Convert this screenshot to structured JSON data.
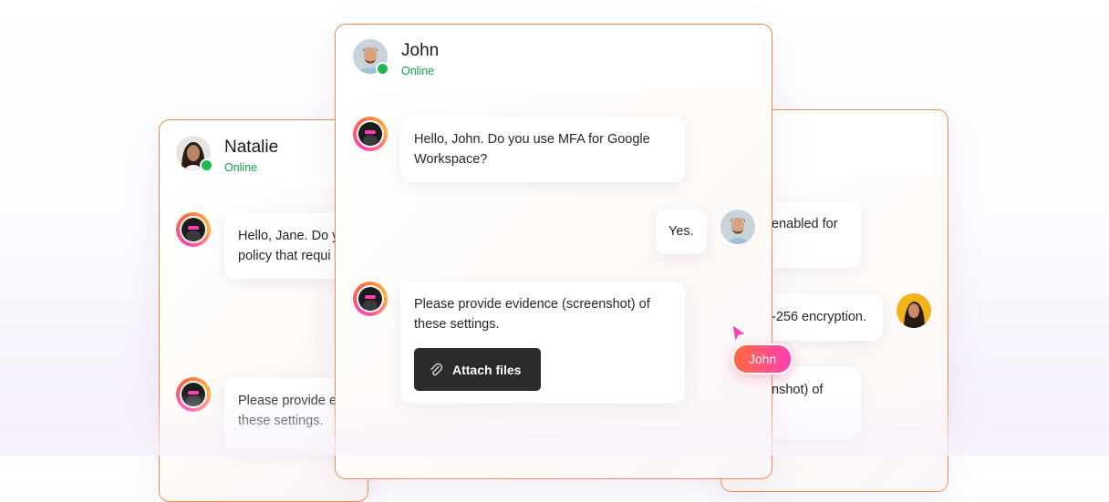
{
  "natalie_card": {
    "name": "Natalie",
    "status": "Online",
    "messages": [
      {
        "line1": "Hello, Jane. Do y",
        "line2": "policy that requi"
      },
      {
        "line1": "Please provide e",
        "line2": "these settings."
      }
    ]
  },
  "john_card": {
    "name": "John",
    "status": "Online",
    "messages": [
      {
        "line1": "Hello, John. Do you use MFA for Google",
        "line2": "Workspace?"
      },
      {
        "text": "Yes."
      },
      {
        "line1": "Please provide evidence (screenshot) of",
        "line2": "these settings."
      }
    ],
    "attach_label": "Attach files"
  },
  "right_card": {
    "messages": [
      {
        "text": "enabled for"
      },
      {
        "text": "-256 encryption."
      },
      {
        "text": "nshot) of"
      }
    ]
  },
  "cursor": {
    "label": "John"
  },
  "colors": {
    "accent_orange": "#f08a4b",
    "accent_pink": "#ff3fb4",
    "online_green": "#12a050"
  }
}
